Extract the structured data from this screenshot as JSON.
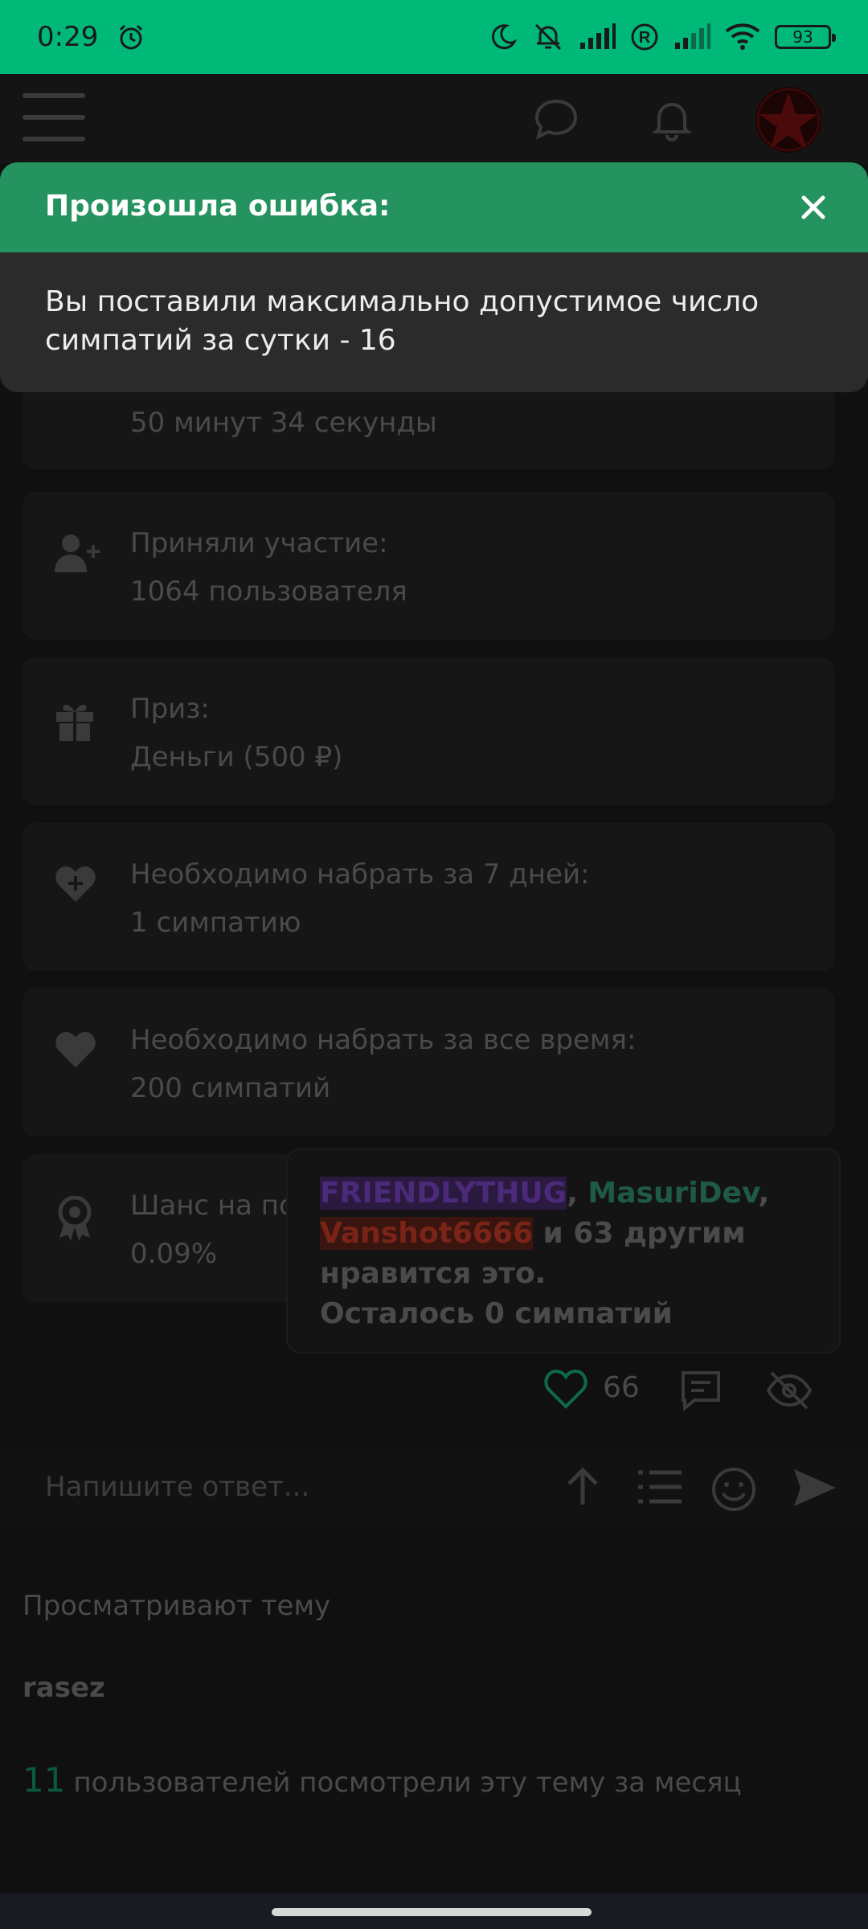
{
  "status_bar": {
    "time": "0:29",
    "battery": "93"
  },
  "colors": {
    "accent": "#24935f",
    "status_bar": "#00b978",
    "toast_body": "#2b2b2b"
  },
  "header": {
    "icons": [
      "menu-icon",
      "chat-icon",
      "bell-icon",
      "avatar"
    ]
  },
  "stats": [
    {
      "icon": "clock-icon",
      "label": "",
      "value": "50 минут 34 секунды"
    },
    {
      "icon": "user-plus-icon",
      "label": "Приняли участие:",
      "value": "1064 пользователя"
    },
    {
      "icon": "gift-icon",
      "label": "Приз:",
      "value": "Деньги (500 ₽)"
    },
    {
      "icon": "heart-plus-icon",
      "label": "Необходимо набрать за 7 дней:",
      "value": "1 симпатию"
    },
    {
      "icon": "heart-icon",
      "label": "Необходимо набрать за все время:",
      "value": "200 симпатий"
    },
    {
      "icon": "award-icon",
      "label": "Шанс на по",
      "value": "0.09%"
    }
  ],
  "likes_tooltip": {
    "user1": "FRIENDLYTHUG",
    "sep1": ", ",
    "user2": "MasuriDev",
    "sep2": ",",
    "user3": "Vanshot6666",
    "rest": " и 63 другим нравится это.",
    "remaining": "Осталось 0 симпатий"
  },
  "actions": {
    "like_count": "66"
  },
  "reply": {
    "placeholder": "Напишите ответ..."
  },
  "viewers": {
    "title": "Просматривают тему",
    "users": [
      "rasez"
    ],
    "month_count": "11",
    "month_text": "пользователей посмотрели эту тему за месяц"
  },
  "toast": {
    "title": "Произошла ошибка:",
    "message": "Вы поставили максимально допустимое число симпатий за сутки - 16"
  }
}
